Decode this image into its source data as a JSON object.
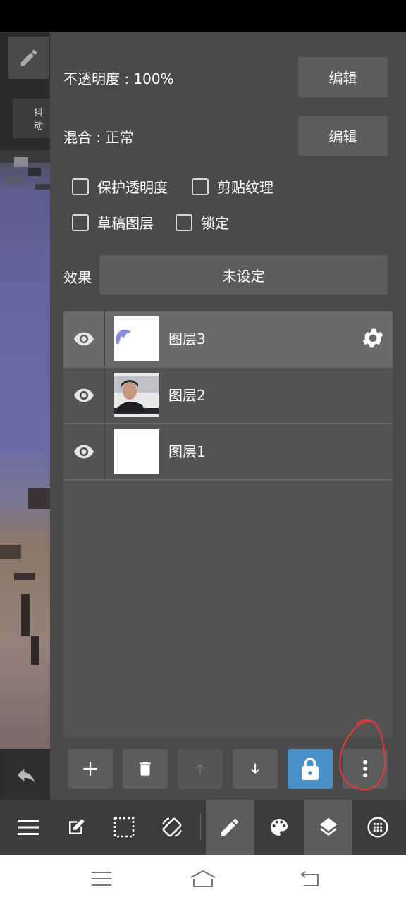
{
  "panel": {
    "opacity_label": "不透明度 : 100%",
    "opacity_edit": "编辑",
    "blend_label": "混合 : 正常",
    "blend_edit": "编辑",
    "checkboxes": {
      "protect_alpha": "保护透明度",
      "clipping": "剪贴纹理",
      "draft_layer": "草稿图层",
      "lock": "锁定"
    },
    "effect_label": "效果",
    "effect_value": "未设定"
  },
  "canvas_strip": {
    "tab_text": "抖动"
  },
  "layers": [
    {
      "name": "图层3",
      "selected": true
    },
    {
      "name": "图层2",
      "selected": false
    },
    {
      "name": "图层1",
      "selected": false
    }
  ],
  "actions": [
    "add-icon",
    "trash-icon",
    "arrow-up-icon",
    "arrow-down-icon",
    "lock-icon",
    "more-vert-icon"
  ],
  "toolbar": [
    "menu-icon",
    "edit-icon",
    "selection-icon",
    "rotate-icon",
    "pen-icon",
    "palette-icon",
    "layers-icon",
    "dots-grid-icon"
  ],
  "colors": {
    "accent": "#4a90c8",
    "panel_bg": "#4a4a4a",
    "annotation_red": "#e03a3a"
  }
}
